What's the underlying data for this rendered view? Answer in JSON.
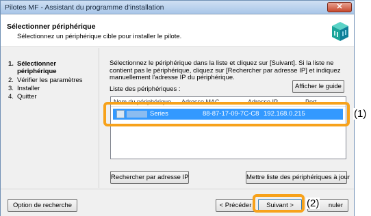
{
  "window": {
    "title": "Pilotes MF - Assistant du programme d'installation",
    "close_icon": "close-icon"
  },
  "header": {
    "title": "Sélectionner périphérique",
    "subtitle": "Sélectionnez un périphérique cible pour installer le pilote."
  },
  "steps": [
    {
      "num": "1.",
      "label": "Sélectionner\npériphérique",
      "active": true
    },
    {
      "num": "2.",
      "label": "Vérifier les paramètres",
      "active": false
    },
    {
      "num": "3.",
      "label": "Installer",
      "active": false
    },
    {
      "num": "4.",
      "label": "Quitter",
      "active": false
    }
  ],
  "content": {
    "description": "Sélectionnez le périphérique dans la liste et cliquez sur [Suivant]. Si la liste ne contient pas le périphérique, cliquez sur [Rechercher par adresse IP] et indiquez manuellement l'adresse IP du périphérique.",
    "guide_button": "Afficher le guide",
    "list_label": "Liste des périphériques :",
    "device_row": {
      "name": "Series",
      "mac": "88-87-17-09-7C-C8",
      "ip": "192.168.0.215"
    },
    "search_ip_button": "Rechercher par adresse IP",
    "refresh_button": "Mettre liste des périphériques à jour"
  },
  "footer": {
    "options_button": "Option de recherche",
    "back_button": "< Précéder",
    "next_button": "Suivant >",
    "cancel_button": "Annuler",
    "cancel_visible": "nuler"
  },
  "callouts": {
    "row": "(1)",
    "next": "(2)"
  },
  "colors": {
    "highlight": "#f7a21b",
    "selection": "#3399ff"
  }
}
